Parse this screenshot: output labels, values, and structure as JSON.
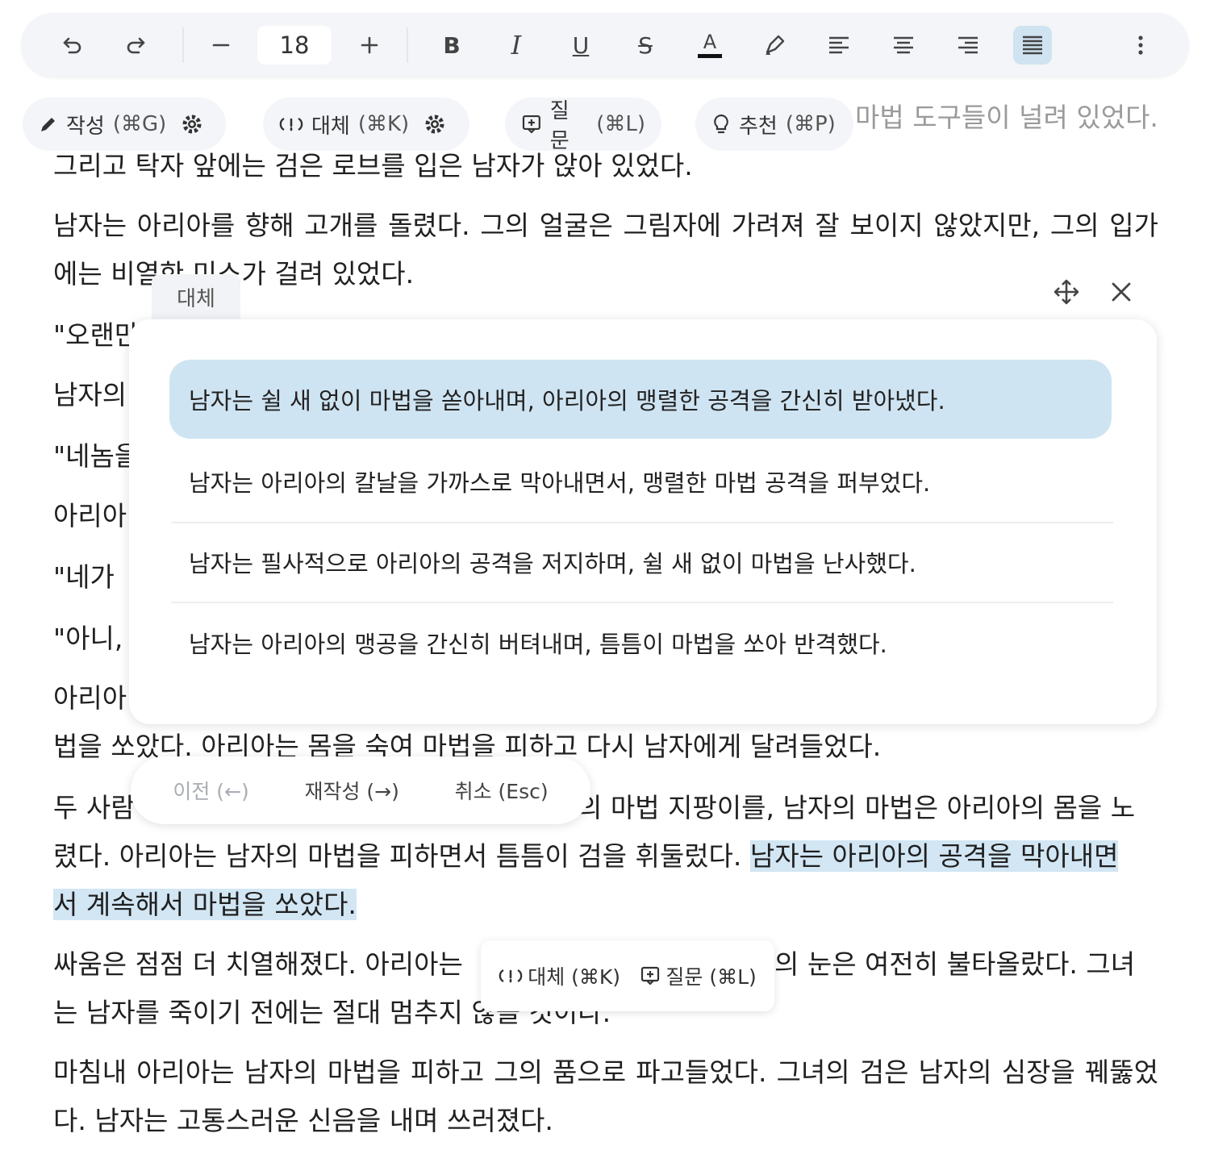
{
  "toolbar": {
    "font_size": "18",
    "undo_icon": "undo-icon",
    "redo_icon": "redo-icon",
    "decrease_icon": "minus-icon",
    "increase_icon": "plus-icon",
    "bold_label": "B",
    "italic_label": "I",
    "underline_label": "U",
    "strike_label": "S",
    "text_color_label": "A",
    "text_color": "#111111",
    "active_alignment": "justify"
  },
  "actions": {
    "write": {
      "label": "작성",
      "shortcut": "(⌘G)"
    },
    "replace": {
      "label": "대체",
      "shortcut": "(⌘K)"
    },
    "ask": {
      "label": "질문",
      "shortcut": "(⌘L)"
    },
    "suggest": {
      "label": "추천",
      "shortcut": "(⌘P)"
    }
  },
  "editor": {
    "line_faded_tail": "마법 도구들이 널려 있었다.",
    "p1_line2": "그리고 탁자 앞에는 검은 로브를 입은 남자가 앉아 있었다.",
    "p2": "남자는 아리아를 향해 고개를 돌렸다. 그의 얼굴은 그림자에 가려져 잘 보이지 않았지만, 그의 입가에는 비열한 미소가 걸려 있었다.",
    "p3_start": "\"오랜만",
    "p4_start": "남자의",
    "p5_start": "\"네놈을",
    "p6_start": "아리아",
    "p7_start": "\"네가",
    "p8_start": "\"아니,",
    "p9_start": "아리아",
    "p9_line2": "법을 쏘았다. 아리아는 몸을 숙여 마법을 피하고 다시 남자에게 달려들었다.",
    "p10_start": "두 사람",
    "p10_line1_tail": "의 마법 지팡이를, 남자의 마법은 아리아의 몸을 노",
    "p10_line2_plain": "렸다. 아리아는 남자의 마법을 피하면서 틈틈이 검을 휘둘렀다.",
    "p10_highlight_a": "남자는 아리아의 공격을 막아내면",
    "p10_highlight_b": "서 계속해서 마법을 쏘았다.",
    "p11_line1_a": "싸움은 점점 더 치열해졌다. 아리아는",
    "p11_line1_b": "의 눈은 여전히 불타올랐다. 그녀",
    "p11_line2": "는 남자를 죽이기 전에는 절대 멈추지 않을 것이다.",
    "p12": "마침내 아리아는 남자의 마법을 피하고 그의 품으로 파고들었다. 그녀의 검은 남자의 심장을 꿰뚫었다. 남자는 고통스러운 신음을 내며 쓰러졌다."
  },
  "replace_panel": {
    "tab_label": "대체",
    "options": [
      "남자는 쉴 새 없이 마법을 쏟아내며, 아리아의 맹렬한 공격을 간신히 받아냈다.",
      "남자는 아리아의 칼날을 가까스로 막아내면서, 맹렬한 마법 공격을 퍼부었다.",
      "남자는 필사적으로 아리아의 공격을 저지하며, 쉴 새 없이 마법을 난사했다.",
      "남자는 아리아의 맹공을 간신히 버텨내며, 틈틈이 마법을 쏘아 반격했다."
    ],
    "selected_index": 0,
    "prev_label": "이전 (←)",
    "rewrite_label": "재작성 (→)",
    "cancel_label": "취소 (Esc)"
  },
  "selection_bar": {
    "replace_label": "대체 (⌘K)",
    "ask_label": "질문 (⌘L)"
  },
  "colors": {
    "highlight": "#d2e6f4",
    "selected_option": "#cfe4f2",
    "toolbar_bg": "#f3f5f8",
    "active_tool": "#cfe3f1"
  }
}
